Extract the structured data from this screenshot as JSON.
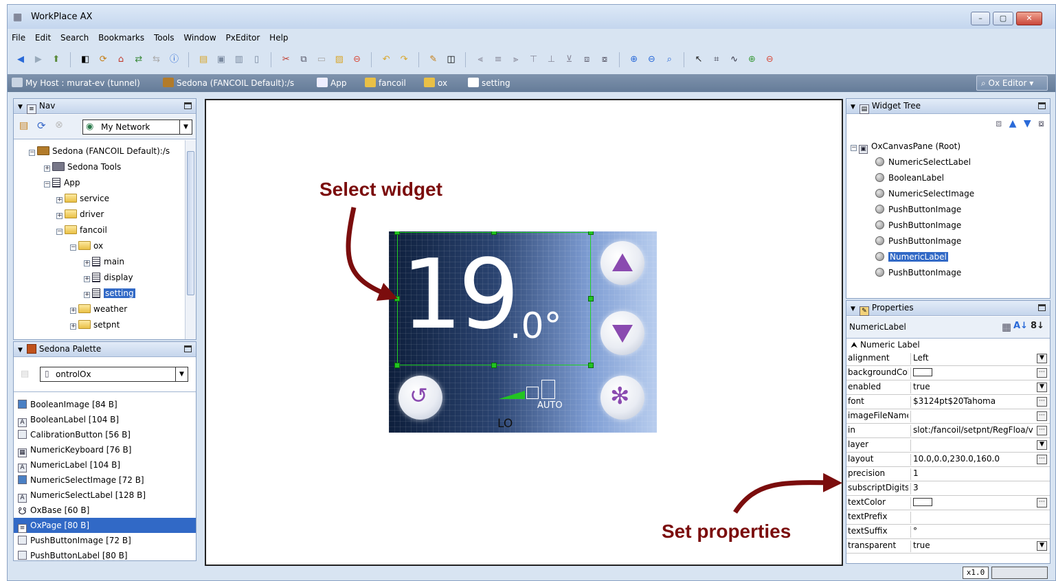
{
  "window": {
    "title": "WorkPlace AX"
  },
  "menu": [
    "File",
    "Edit",
    "Search",
    "Bookmarks",
    "Tools",
    "Window",
    "PxEditor",
    "Help"
  ],
  "pathbar": {
    "host": "My Host : murat-ev (tunnel)",
    "station": "Sedona (FANCOIL Default):/s",
    "app": "App",
    "fancoil": "fancoil",
    "ox": "ox",
    "setting": "setting",
    "editor": "Ox Editor"
  },
  "nav": {
    "title": "Nav",
    "network": "My Network",
    "tree": [
      "Sedona (FANCOIL Default):/s",
      "Sedona Tools",
      "App",
      "service",
      "driver",
      "fancoil",
      "ox",
      "main",
      "display",
      "setting",
      "weather",
      "setpnt"
    ]
  },
  "palette": {
    "title": "Sedona Palette",
    "kit": "ontrolOx",
    "items": [
      "BooleanImage [84 B]",
      "BooleanLabel [104 B]",
      "CalibrationButton [56 B]",
      "NumericKeyboard [76 B]",
      "NumericLabel [104 B]",
      "NumericSelectImage [72 B]",
      "NumericSelectLabel [128 B]",
      "OxBase [60 B]",
      "OxPage [80 B]",
      "PushButtonImage [72 B]",
      "PushButtonLabel [80 B]"
    ],
    "selected_index": 8
  },
  "canvas": {
    "temp_int": "19",
    "temp_dec": ".0°",
    "fan_mode": "AUTO",
    "fan_speed": "LO",
    "annot_select": "Select widget",
    "annot_props": "Set properties"
  },
  "widget_tree": {
    "title": "Widget Tree",
    "root": "OxCanvasPane (Root)",
    "items": [
      "NumericSelectLabel",
      "BooleanLabel",
      "NumericSelectImage",
      "PushButtonImage",
      "PushButtonImage",
      "PushButtonImage",
      "NumericLabel",
      "PushButtonImage"
    ],
    "selected_index": 6
  },
  "properties": {
    "title": "Properties",
    "target": "NumericLabel",
    "section": "Numeric Label",
    "rows": [
      {
        "name": "alignment",
        "value": "Left"
      },
      {
        "name": "backgroundColor",
        "value": ""
      },
      {
        "name": "enabled",
        "value": "true"
      },
      {
        "name": "font",
        "value": "$3124pt$20Tahoma"
      },
      {
        "name": "imageFileName",
        "value": ""
      },
      {
        "name": "in",
        "value": "slot:/fancoil/setpnt/RegFloa/v"
      },
      {
        "name": "layer",
        "value": ""
      },
      {
        "name": "layout",
        "value": "10.0,0.0,230.0,160.0"
      },
      {
        "name": "precision",
        "value": "1"
      },
      {
        "name": "subscriptDigits",
        "value": "3"
      },
      {
        "name": "textColor",
        "value": ""
      },
      {
        "name": "textPrefix",
        "value": ""
      },
      {
        "name": "textSuffix",
        "value": "°"
      },
      {
        "name": "transparent",
        "value": "true"
      }
    ]
  },
  "status": {
    "zoom": "x1.0"
  },
  "colors": {
    "accent": "#3169c6",
    "annotation": "#7b0d0d",
    "selection": "#22d422"
  }
}
